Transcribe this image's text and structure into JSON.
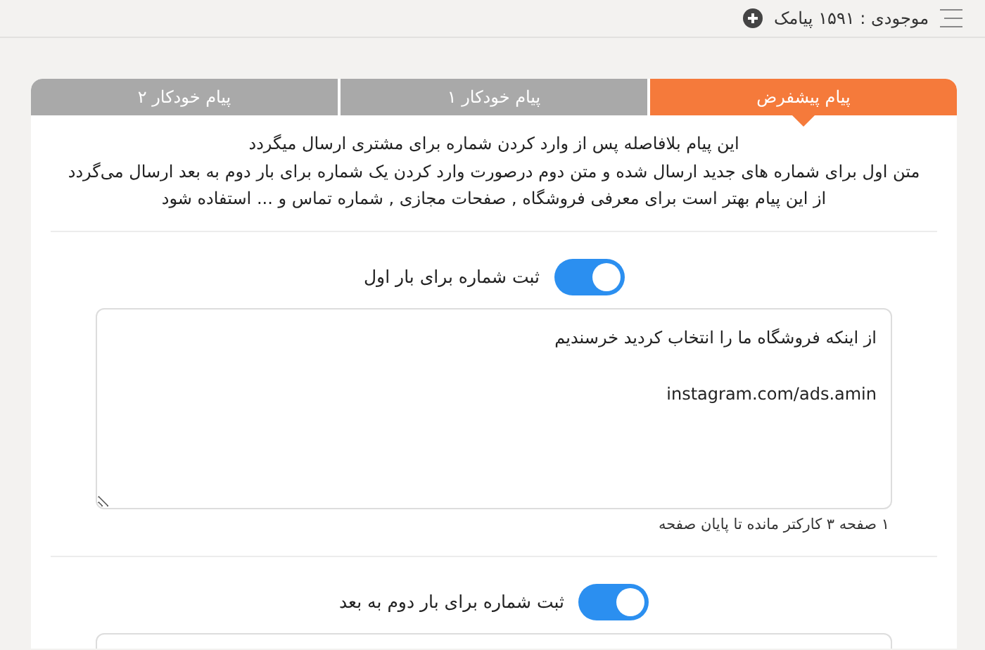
{
  "header": {
    "balance": "موجودی : ۱۵۹۱ پیامک"
  },
  "tabs": [
    {
      "label": "پیام پیشفرض",
      "selected": true
    },
    {
      "label": "پیام خودکار ۱",
      "selected": false
    },
    {
      "label": "پیام خودکار ۲",
      "selected": false
    }
  ],
  "description": [
    "این پیام بلافاصله پس از وارد کردن شماره برای مشتری ارسال میگردد",
    "متن اول برای شماره های جدید ارسال شده و متن دوم درصورت وارد کردن یک شماره برای بار دوم به بعد ارسال می‌گردد",
    "از این پیام بهتر است برای معرفی فروشگاه , صفحات مجازی , شماره تماس و ... استفاده شود"
  ],
  "sections": [
    {
      "label": "ثبت شماره برای بار اول",
      "on": true,
      "value": "از اینکه فروشگاه ما را انتخاب کردید خرسندیم\n\ninstagram.com/ads.amin",
      "counter": "۱ صفحه ۳ کارکتر مانده تا پایان صفحه"
    },
    {
      "label": "ثبت شماره برای بار دوم به بعد",
      "on": true
    }
  ]
}
